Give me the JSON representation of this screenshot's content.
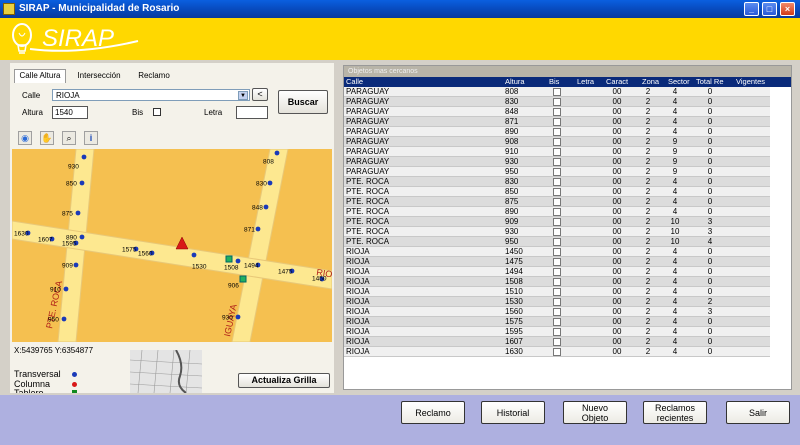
{
  "window": {
    "title": "SIRAP - Municipalidad de Rosario"
  },
  "header": {
    "logo_text": "SIRAP"
  },
  "search": {
    "tabs": [
      {
        "label": "Calle Altura",
        "active": true
      },
      {
        "label": "Intersección",
        "active": false
      },
      {
        "label": "Reclamo",
        "active": false
      }
    ],
    "calle_label": "Calle",
    "calle_value": "RIOJA",
    "back_button": "<",
    "altura_label": "Altura",
    "altura_value": "1540",
    "bis_label": "Bis",
    "letra_label": "Letra",
    "letra_value": "",
    "buscar_button": "Buscar"
  },
  "map_tools": [
    "globe-icon",
    "hand-icon",
    "zoom-icon",
    "info-icon"
  ],
  "map": {
    "street_labels": [
      "PTE. ROCA",
      "IGUAYA",
      "RIO"
    ],
    "markers": [
      {
        "id": "930a",
        "label": "930"
      },
      {
        "id": "808",
        "label": "808"
      },
      {
        "id": "850",
        "label": "850"
      },
      {
        "id": "830",
        "label": "830"
      },
      {
        "id": "848",
        "label": "848"
      },
      {
        "id": "875",
        "label": "875"
      },
      {
        "id": "890",
        "label": "890"
      },
      {
        "id": "871",
        "label": "871"
      },
      {
        "id": "1630",
        "label": "1630"
      },
      {
        "id": "1607",
        "label": "1607"
      },
      {
        "id": "1595",
        "label": "1595"
      },
      {
        "id": "1575",
        "label": "1575"
      },
      {
        "id": "1560",
        "label": "1560"
      },
      {
        "id": "909",
        "label": "909"
      },
      {
        "id": "1530",
        "label": "1530"
      },
      {
        "id": "1508",
        "label": "1508"
      },
      {
        "id": "1494",
        "label": "1494"
      },
      {
        "id": "1475",
        "label": "1475"
      },
      {
        "id": "1450",
        "label": "1450"
      },
      {
        "id": "906",
        "label": "906"
      },
      {
        "id": "910",
        "label": "910"
      },
      {
        "id": "930b",
        "label": "930"
      },
      {
        "id": "950",
        "label": "950"
      }
    ]
  },
  "coords_text": "X:5439765 Y:6354877",
  "legend": [
    {
      "label": "Transversal",
      "color": "#1a3ab8"
    },
    {
      "label": "Columna",
      "color": "#d81818"
    },
    {
      "label": "Tablero",
      "color": "#108a20"
    }
  ],
  "actualiza_button": "Actualiza Grilla",
  "grid": {
    "title": "Objetos mas cercanos",
    "columns": [
      "Calle",
      "Altura",
      "Bis",
      "Letra",
      "Caract",
      "Zona",
      "Sector",
      "Total Re",
      "Vigentes"
    ],
    "rows": [
      [
        "PARAGUAY",
        "808",
        "",
        "",
        "00",
        "2",
        "4",
        "0",
        ""
      ],
      [
        "PARAGUAY",
        "830",
        "",
        "",
        "00",
        "2",
        "4",
        "0",
        ""
      ],
      [
        "PARAGUAY",
        "848",
        "",
        "",
        "00",
        "2",
        "4",
        "0",
        ""
      ],
      [
        "PARAGUAY",
        "871",
        "",
        "",
        "00",
        "2",
        "4",
        "0",
        ""
      ],
      [
        "PARAGUAY",
        "890",
        "",
        "",
        "00",
        "2",
        "4",
        "0",
        ""
      ],
      [
        "PARAGUAY",
        "908",
        "",
        "",
        "00",
        "2",
        "9",
        "0",
        ""
      ],
      [
        "PARAGUAY",
        "910",
        "",
        "",
        "00",
        "2",
        "9",
        "0",
        ""
      ],
      [
        "PARAGUAY",
        "930",
        "",
        "",
        "00",
        "2",
        "9",
        "0",
        ""
      ],
      [
        "PARAGUAY",
        "950",
        "",
        "",
        "00",
        "2",
        "9",
        "0",
        ""
      ],
      [
        "PTE. ROCA",
        "830",
        "",
        "",
        "00",
        "2",
        "4",
        "0",
        ""
      ],
      [
        "PTE. ROCA",
        "850",
        "",
        "",
        "00",
        "2",
        "4",
        "0",
        ""
      ],
      [
        "PTE. ROCA",
        "875",
        "",
        "",
        "00",
        "2",
        "4",
        "0",
        ""
      ],
      [
        "PTE. ROCA",
        "890",
        "",
        "",
        "00",
        "2",
        "4",
        "0",
        ""
      ],
      [
        "PTE. ROCA",
        "909",
        "",
        "",
        "00",
        "2",
        "10",
        "3",
        ""
      ],
      [
        "PTE. ROCA",
        "930",
        "",
        "",
        "00",
        "2",
        "10",
        "3",
        ""
      ],
      [
        "PTE. ROCA",
        "950",
        "",
        "",
        "00",
        "2",
        "10",
        "4",
        ""
      ],
      [
        "RIOJA",
        "1450",
        "",
        "",
        "00",
        "2",
        "4",
        "0",
        ""
      ],
      [
        "RIOJA",
        "1475",
        "",
        "",
        "00",
        "2",
        "4",
        "0",
        ""
      ],
      [
        "RIOJA",
        "1494",
        "",
        "",
        "00",
        "2",
        "4",
        "0",
        ""
      ],
      [
        "RIOJA",
        "1508",
        "",
        "",
        "00",
        "2",
        "4",
        "0",
        ""
      ],
      [
        "RIOJA",
        "1510",
        "",
        "",
        "00",
        "2",
        "4",
        "0",
        ""
      ],
      [
        "RIOJA",
        "1530",
        "",
        "",
        "00",
        "2",
        "4",
        "2",
        ""
      ],
      [
        "RIOJA",
        "1560",
        "",
        "",
        "00",
        "2",
        "4",
        "3",
        ""
      ],
      [
        "RIOJA",
        "1575",
        "",
        "",
        "00",
        "2",
        "4",
        "0",
        ""
      ],
      [
        "RIOJA",
        "1595",
        "",
        "",
        "00",
        "2",
        "4",
        "0",
        ""
      ],
      [
        "RIOJA",
        "1607",
        "",
        "",
        "00",
        "2",
        "4",
        "0",
        ""
      ],
      [
        "RIOJA",
        "1630",
        "",
        "",
        "00",
        "2",
        "4",
        "0",
        ""
      ]
    ]
  },
  "bottom_buttons": [
    {
      "label": "Reclamo"
    },
    {
      "label": "Historial"
    },
    {
      "label": "Nuevo\nObjeto"
    },
    {
      "label": "Reclamos\nrecientes"
    },
    {
      "label": "Salir"
    }
  ],
  "colors": {
    "header": "#ffd800",
    "grid_header": "#0a2a7a",
    "map_block": "#f5c050",
    "map_street": "#fde890",
    "marker": "#1a3ab8",
    "columna": "#d81818",
    "tablero": "#20b060",
    "bottom_bar": "#aeb0e0"
  }
}
